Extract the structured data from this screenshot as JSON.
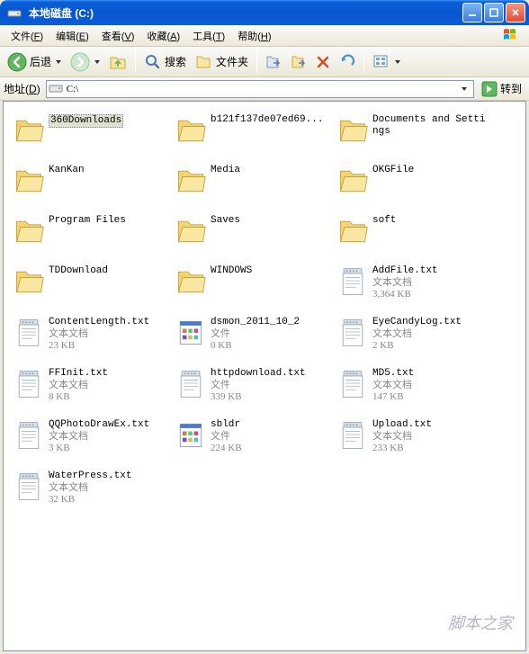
{
  "titlebar": {
    "title": "本地磁盘 (C:)"
  },
  "menus": {
    "file": {
      "label": "文件",
      "key": "F"
    },
    "edit": {
      "label": "编辑",
      "key": "E"
    },
    "view": {
      "label": "查看",
      "key": "V"
    },
    "fav": {
      "label": "收藏",
      "key": "A"
    },
    "tools": {
      "label": "工具",
      "key": "T"
    },
    "help": {
      "label": "帮助",
      "key": "H"
    }
  },
  "toolbar": {
    "back": "后退",
    "search": "搜索",
    "folders": "文件夹"
  },
  "addressbar": {
    "label": "地址",
    "key": "D",
    "path": "C:\\",
    "go": "转到"
  },
  "items": [
    {
      "type": "folder",
      "name": "360Downloads",
      "selected": true
    },
    {
      "type": "folder",
      "name": "b121f137de07ed69..."
    },
    {
      "type": "folder",
      "name": "Documents and Settings"
    },
    {
      "type": "folder",
      "name": "KanKan"
    },
    {
      "type": "folder",
      "name": "Media"
    },
    {
      "type": "folder",
      "name": "OKGFile"
    },
    {
      "type": "folder",
      "name": "Program Files"
    },
    {
      "type": "folder",
      "name": "Saves"
    },
    {
      "type": "folder",
      "name": "soft"
    },
    {
      "type": "folder",
      "name": "TDDownload"
    },
    {
      "type": "folder",
      "name": "WINDOWS"
    },
    {
      "type": "txt",
      "name": "AddFile.txt",
      "kind": "文本文档",
      "size": "3,364 KB"
    },
    {
      "type": "txt",
      "name": "ContentLength.txt",
      "kind": "文本文档",
      "size": "23 KB"
    },
    {
      "type": "app",
      "name": "dsmon_2011_10_2",
      "kind": "文件",
      "size": "0 KB"
    },
    {
      "type": "txt",
      "name": "EyeCandyLog.txt",
      "kind": "文本文档",
      "size": "2 KB"
    },
    {
      "type": "txt",
      "name": "FFInit.txt",
      "kind": "文本文档",
      "size": "8 KB"
    },
    {
      "type": "txt",
      "name": "httpdownload.txt",
      "kind": "文件",
      "size": "339 KB"
    },
    {
      "type": "txt",
      "name": "MD5.txt",
      "kind": "文本文档",
      "size": "147 KB"
    },
    {
      "type": "txt",
      "name": "QQPhotoDrawEx.txt",
      "kind": "文本文档",
      "size": "3 KB"
    },
    {
      "type": "app",
      "name": "sbldr",
      "kind": "文件",
      "size": "224 KB"
    },
    {
      "type": "txt",
      "name": "Upload.txt",
      "kind": "文本文档",
      "size": "233 KB"
    },
    {
      "type": "txt",
      "name": "WaterPress.txt",
      "kind": "文本文档",
      "size": "32 KB"
    }
  ],
  "watermark": "脚本之家"
}
